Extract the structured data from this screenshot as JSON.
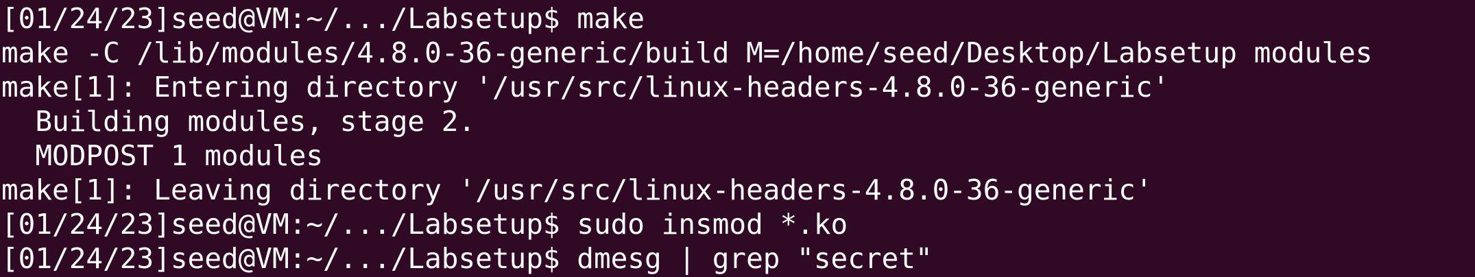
{
  "terminal": {
    "lines": [
      "[01/24/23]seed@VM:~/.../Labsetup$ make",
      "make -C /lib/modules/4.8.0-36-generic/build M=/home/seed/Desktop/Labsetup modules",
      "make[1]: Entering directory '/usr/src/linux-headers-4.8.0-36-generic'",
      "  Building modules, stage 2.",
      "  MODPOST 1 modules",
      "make[1]: Leaving directory '/usr/src/linux-headers-4.8.0-36-generic'",
      "[01/24/23]seed@VM:~/.../Labsetup$ sudo insmod *.ko",
      "[01/24/23]seed@VM:~/.../Labsetup$ dmesg | grep \"secret\""
    ]
  },
  "colors": {
    "background": "#300a24",
    "foreground": "#ffffff"
  }
}
